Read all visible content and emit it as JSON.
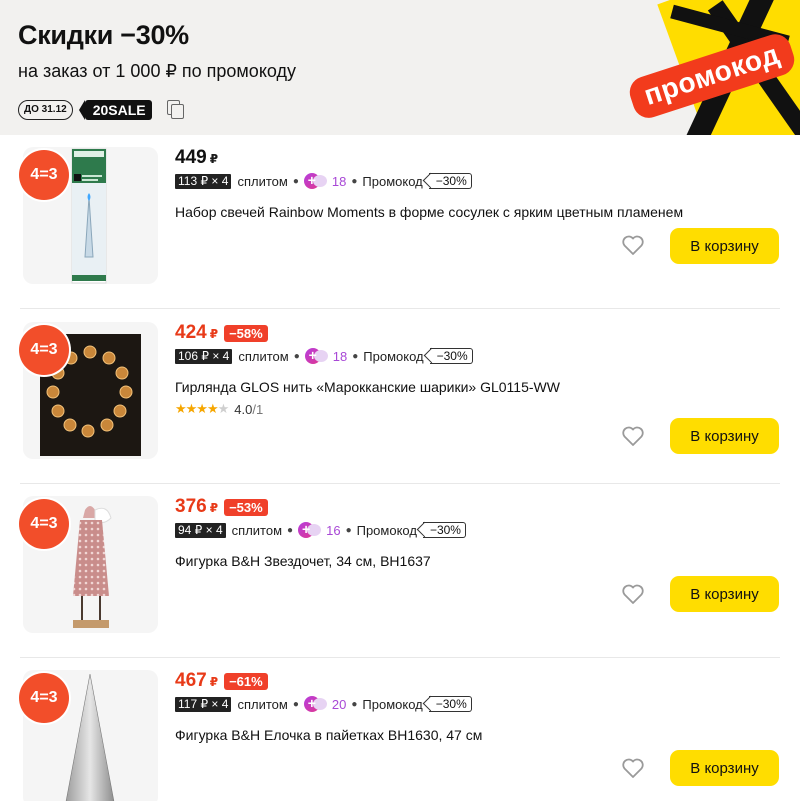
{
  "banner": {
    "title": "Скидки −30%",
    "subtitle": "на заказ от 1 000 ₽ по промокоду",
    "until": "ДО 31.12",
    "code": "20SALE",
    "art_label": "промокод",
    "accent_yellow": "#ffdd00",
    "accent_red": "#f23b1c"
  },
  "products": [
    {
      "badge": "4=3",
      "price": "449",
      "currency": "₽",
      "discount": "",
      "split": "113 ₽ × 4",
      "split_word": "сплитом",
      "plus_points": "18",
      "promo_word": "Промокод",
      "promo_value": "−30%",
      "title": "Набор свечей Rainbow Moments в форме сосулек с ярким цветным пламенем",
      "rating": "",
      "rating_count": "",
      "cart_label": "В корзину",
      "image": "candles-icon"
    },
    {
      "badge": "4=3",
      "price": "424",
      "currency": "₽",
      "discount": "−58%",
      "split": "106 ₽ × 4",
      "split_word": "сплитом",
      "plus_points": "18",
      "promo_word": "Промокод",
      "promo_value": "−30%",
      "title": "Гирлянда GLOS нить «Марокканские шарики» GL0115-WW",
      "rating": "4.0",
      "rating_count": "/1",
      "stars_filled": 4,
      "cart_label": "В корзину",
      "image": "garland-icon"
    },
    {
      "badge": "4=3",
      "price": "376",
      "currency": "₽",
      "discount": "−53%",
      "split": "94 ₽ × 4",
      "split_word": "сплитом",
      "plus_points": "16",
      "promo_word": "Промокод",
      "promo_value": "−30%",
      "title": "Фигурка B&H Звездочет, 34 см, BH1637",
      "rating": "",
      "rating_count": "",
      "cart_label": "В корзину",
      "image": "figurine-icon"
    },
    {
      "badge": "4=3",
      "price": "467",
      "currency": "₽",
      "discount": "−61%",
      "split": "117 ₽ × 4",
      "split_word": "сплитом",
      "plus_points": "20",
      "promo_word": "Промокод",
      "promo_value": "−30%",
      "title": "Фигурка B&H Елочка в пайетках BH1630, 47 см",
      "rating": "",
      "rating_count": "",
      "cart_label": "В корзину",
      "image": "tree-figurine-icon"
    }
  ]
}
